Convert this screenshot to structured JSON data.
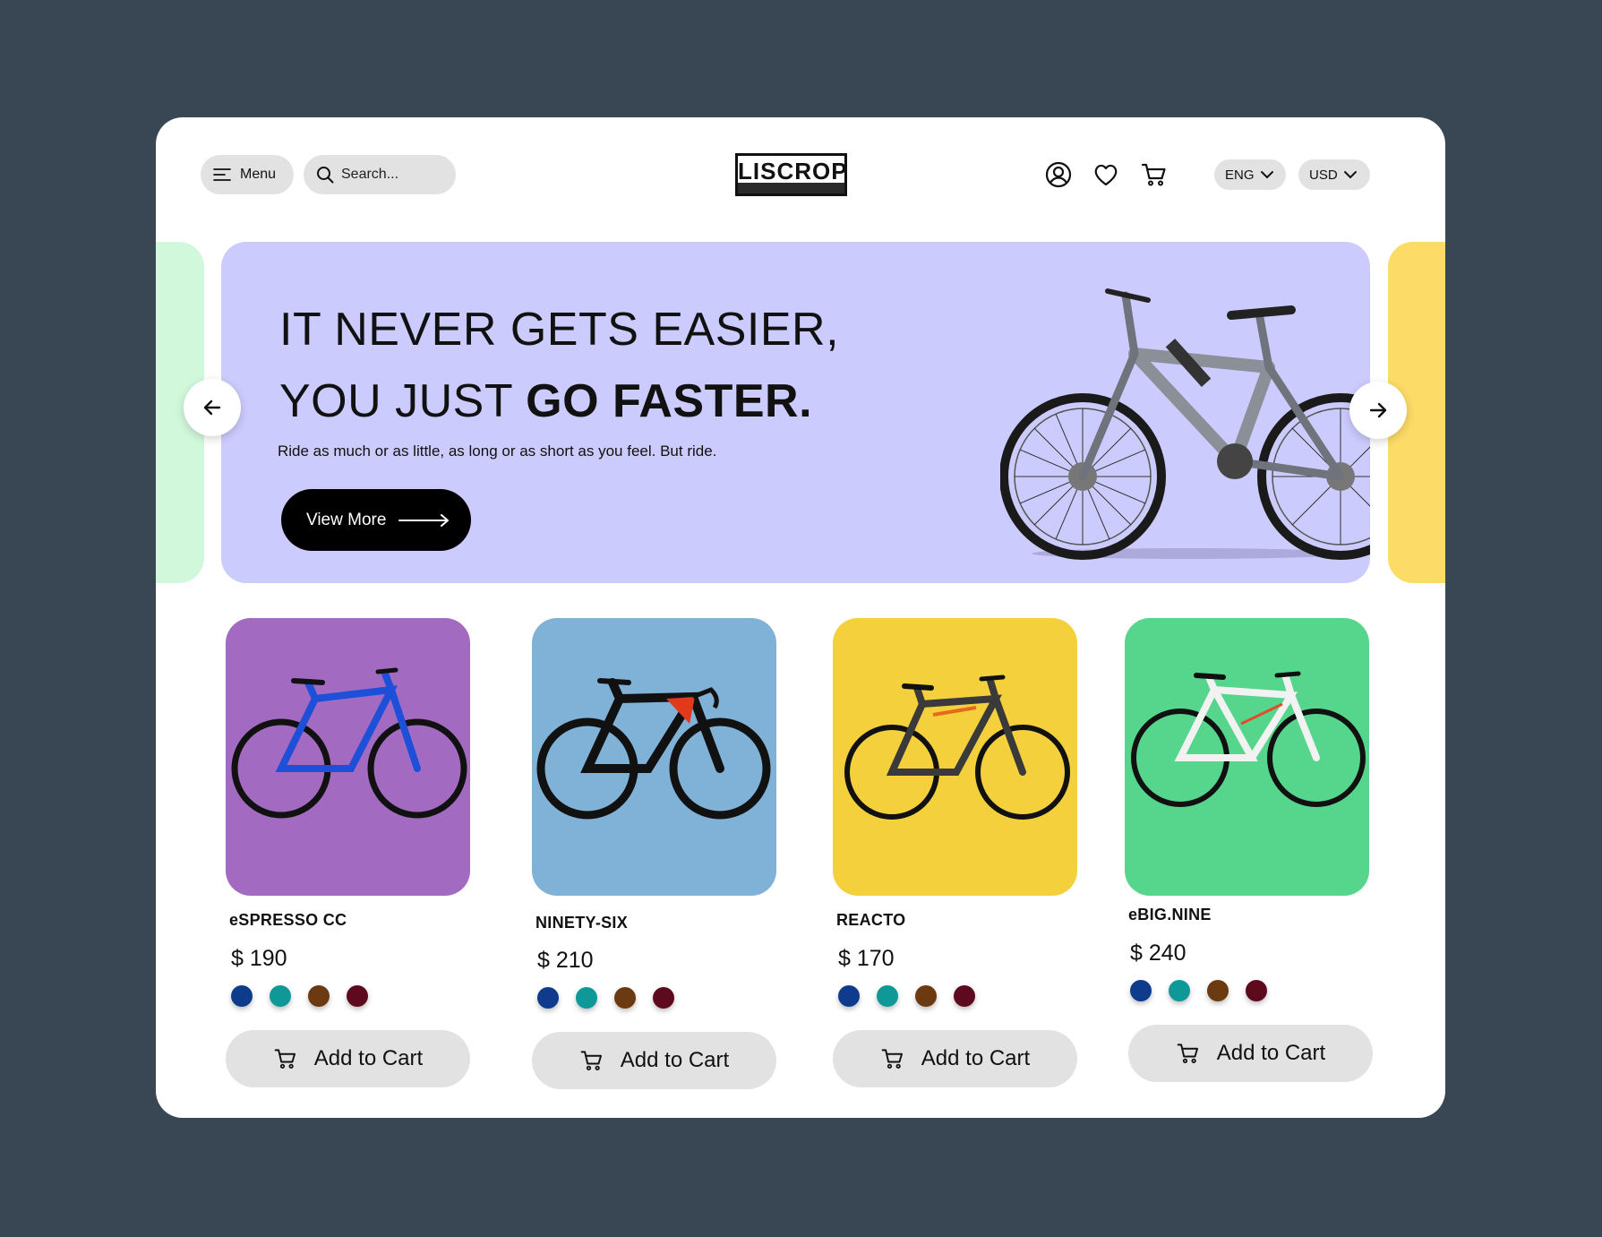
{
  "header": {
    "menu_label": "Menu",
    "search_placeholder": "Search...",
    "logo": "LISCROP",
    "language": "ENG",
    "currency": "USD",
    "icons": [
      "user-icon",
      "heart-icon",
      "cart-icon"
    ]
  },
  "hero": {
    "line1": "IT NEVER GETS EASIER,",
    "line2_regular": "YOU JUST ",
    "line2_bold": "GO FASTER.",
    "subtitle": "Ride as much or as little, as long or as short as you feel. But ride.",
    "button_label": "View More",
    "background": "#cccbfd"
  },
  "products": [
    {
      "name": "eSPRESSO CC",
      "price": "$ 190",
      "card_color": "#a26ac0",
      "colors": [
        "#0e3b8c",
        "#0e9898",
        "#6b3a11",
        "#5e0a1e"
      ]
    },
    {
      "name": "NINETY-SIX",
      "price": "$ 210",
      "card_color": "#7fb2d6",
      "colors": [
        "#0e3b8c",
        "#0e9898",
        "#6b3a11",
        "#5e0a1e"
      ]
    },
    {
      "name": "REACTO",
      "price": "$ 170",
      "card_color": "#f4d13c",
      "colors": [
        "#0e3b8c",
        "#0e9898",
        "#6b3a11",
        "#5e0a1e"
      ]
    },
    {
      "name": "eBIG.NINE",
      "price": "$ 240",
      "card_color": "#56d68c",
      "colors": [
        "#0e3b8c",
        "#0e9898",
        "#6b3a11",
        "#5e0a1e"
      ]
    }
  ],
  "cart_label": "Add to Cart"
}
